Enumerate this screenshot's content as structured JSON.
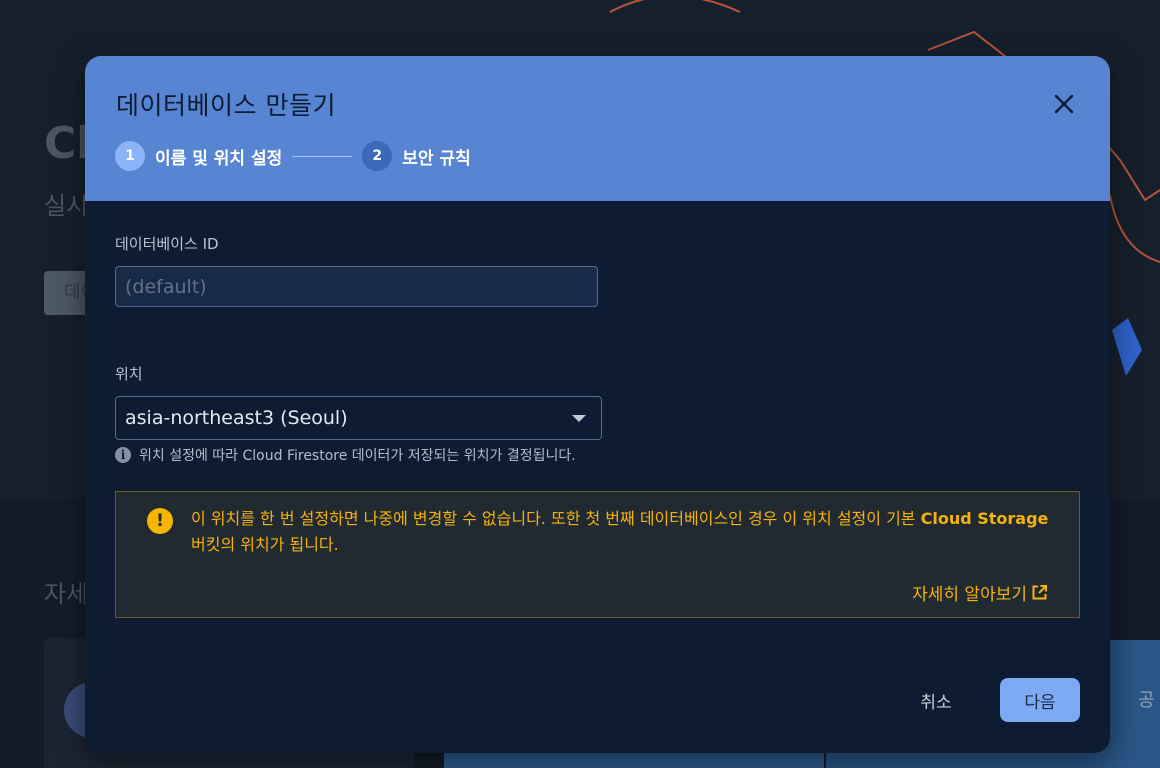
{
  "background": {
    "title": "Cl",
    "subtitle": "실시",
    "button_label": "데이",
    "section_title": "자세",
    "card_text": "공"
  },
  "dialog": {
    "title": "데이터베이스 만들기",
    "steps": [
      {
        "number": "1",
        "label": "이름 및 위치 설정",
        "active": true
      },
      {
        "number": "2",
        "label": "보안 규칙",
        "active": false
      }
    ],
    "database_id": {
      "label": "데이터베이스 ID",
      "value": "",
      "placeholder": "(default)"
    },
    "location": {
      "label": "위치",
      "selected": "asia-northeast3 (Seoul)",
      "hint": "위치 설정에 따라 Cloud Firestore 데이터가 저장되는 위치가 결정됩니다."
    },
    "warning": {
      "text_part1": "이 위치를 한 번 설정하면 나중에 변경할 수 없습니다. 또한 첫 번째 데이터베이스인 경우 이 위치 설정이 기본 ",
      "text_strong": "Cloud Storage",
      "text_part2": " 버킷의 위치가 됩니다.",
      "learn_more": "자세히 알아보기"
    },
    "actions": {
      "cancel": "취소",
      "next": "다음"
    }
  },
  "colors": {
    "header_bg": "#5785d2",
    "dialog_bg": "#0e1c33",
    "warning_text": "#f5b20a",
    "primary_button": "#7eaaf3"
  },
  "icons": {
    "close": "close-icon",
    "dropdown": "chevron-down-icon",
    "info": "info-icon",
    "warning": "warning-icon",
    "external": "open-in-new-icon"
  }
}
